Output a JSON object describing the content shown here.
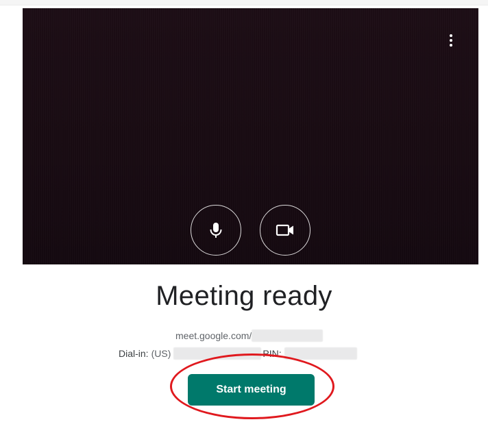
{
  "preview": {
    "more_options_icon": "more-vert-icon",
    "mic_icon": "microphone-icon",
    "camera_icon": "video-camera-icon",
    "background_color": "#180b12"
  },
  "meeting": {
    "title": "Meeting ready",
    "link_prefix": "meet.google.com/",
    "dialin_label": "Dial-in:",
    "dialin_country": "(US)",
    "pin_label": "PIN:"
  },
  "actions": {
    "start_label": "Start meeting",
    "start_color": "#00796b"
  },
  "annotation": {
    "highlight_color": "#e0191e"
  }
}
